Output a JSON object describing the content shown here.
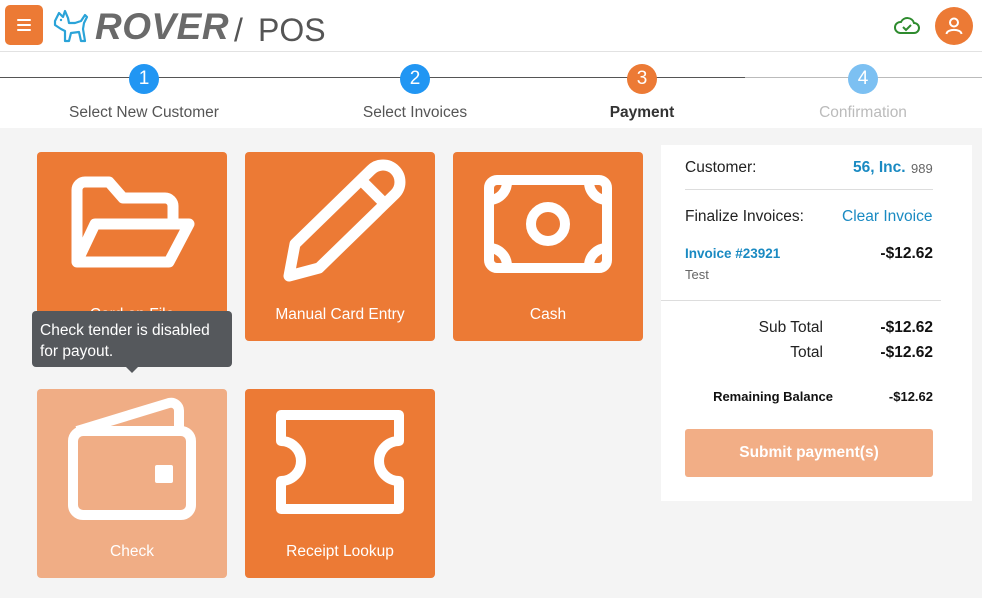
{
  "header": {
    "brand": "ROVER",
    "separator": "/",
    "product": "POS"
  },
  "steps": [
    {
      "number": "1",
      "label": "Select New Customer",
      "color": "#2196f3"
    },
    {
      "number": "2",
      "label": "Select Invoices",
      "color": "#2196f3"
    },
    {
      "number": "3",
      "label": "Payment",
      "color": "#ec7a35"
    },
    {
      "number": "4",
      "label": "Confirmation",
      "color": "#7cc0f2"
    }
  ],
  "tenders": {
    "card_on_file": "Card on File",
    "manual_card_entry": "Manual Card Entry",
    "cash": "Cash",
    "check": "Check",
    "receipt_lookup": "Receipt Lookup"
  },
  "tooltip": {
    "line1": "Check tender is disabled",
    "line2": "for payout."
  },
  "summary": {
    "customer_label": "Customer:",
    "customer_name": "56, Inc.",
    "customer_id": "989",
    "finalize_label": "Finalize Invoices:",
    "clear_invoice": "Clear Invoice",
    "invoice_number": "Invoice #23921",
    "invoice_description": "Test",
    "invoice_amount": "-$12.62",
    "subtotal_label": "Sub Total",
    "subtotal_value": "-$12.62",
    "total_label": "Total",
    "total_value": "-$12.62",
    "remaining_label": "Remaining Balance",
    "remaining_value": "-$12.62",
    "submit_label": "Submit payment(s)"
  },
  "colors": {
    "accent": "#ec7a35",
    "accent_disabled": "#f0ad85",
    "link": "#1a8ac2",
    "step_active": "#2196f3"
  }
}
